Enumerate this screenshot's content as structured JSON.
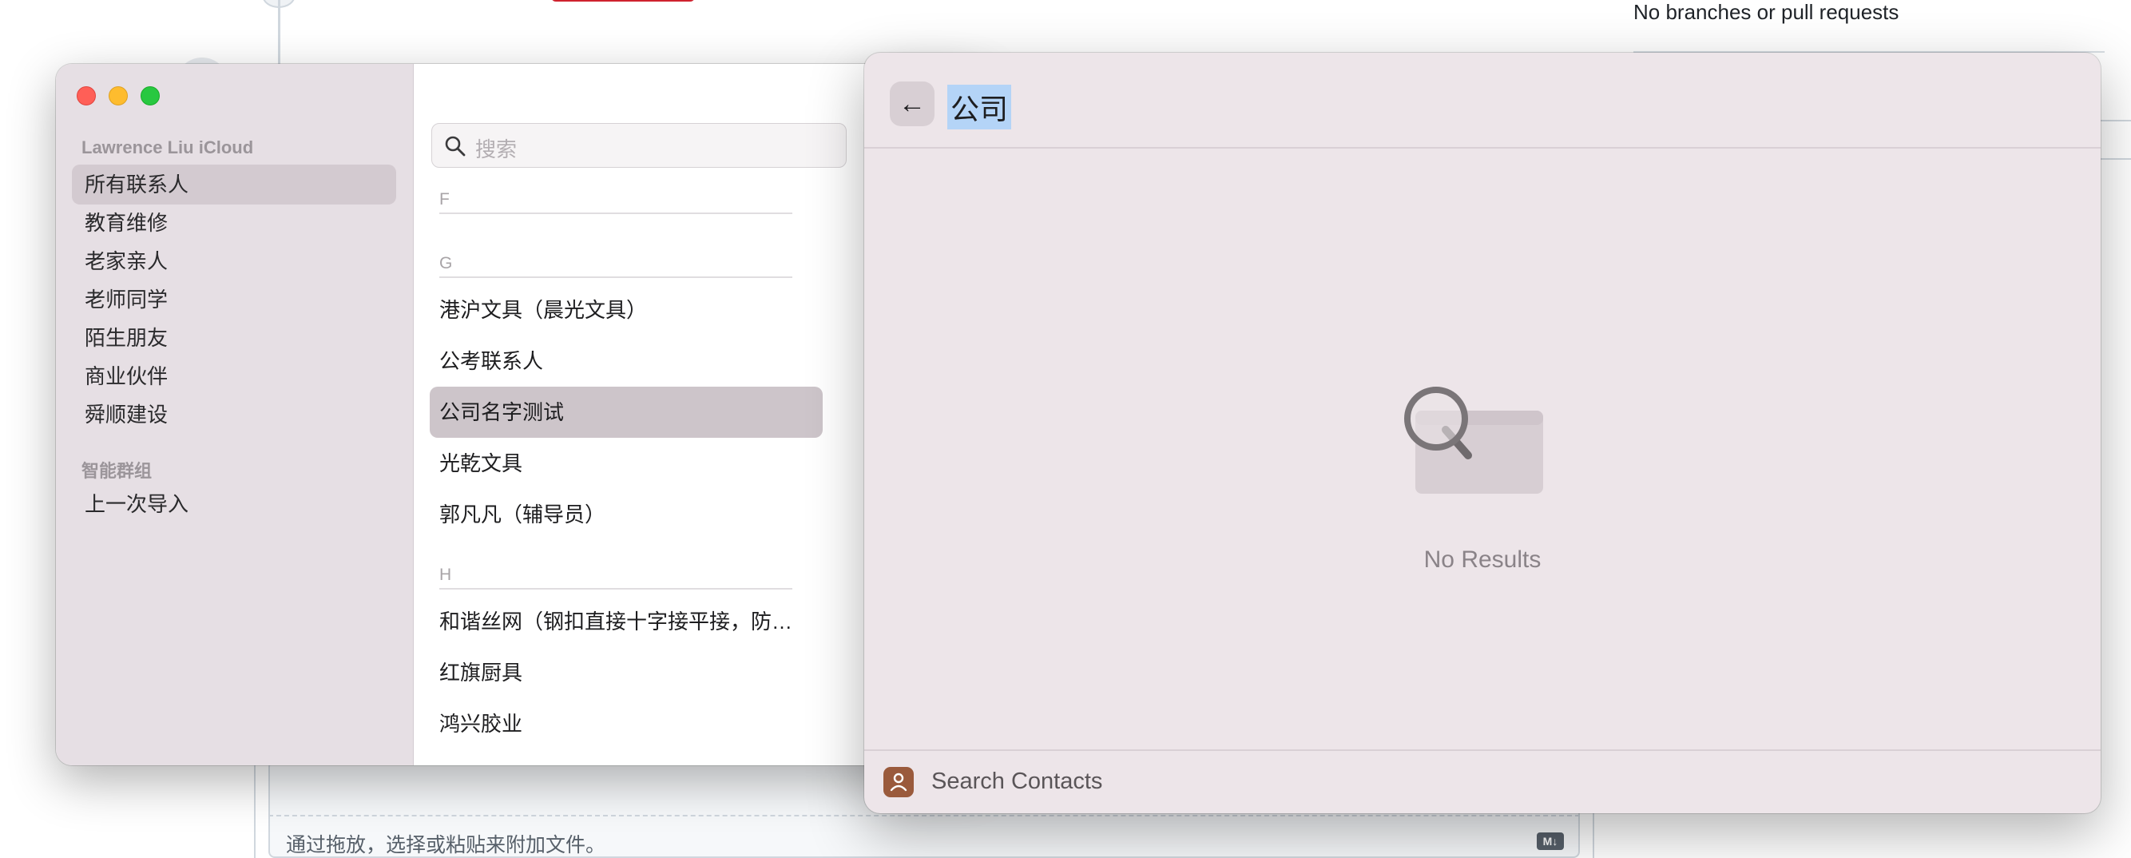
{
  "background_page": {
    "right_panel_text": "No branches or pull requests",
    "attach_hint": "通过拖放，选择或粘贴来附加文件。",
    "markdown_badge": "M↓"
  },
  "contacts": {
    "sidebar": {
      "account_header": "Lawrence Liu iCloud",
      "groups": [
        {
          "label": "所有联系人",
          "selected": true
        },
        {
          "label": "教育维修"
        },
        {
          "label": "老家亲人"
        },
        {
          "label": "老师同学"
        },
        {
          "label": "陌生朋友"
        },
        {
          "label": "商业伙伴"
        },
        {
          "label": "舜顺建设"
        }
      ],
      "smart_groups_header": "智能群组",
      "smart_groups": [
        {
          "label": "上一次导入"
        }
      ]
    },
    "list": {
      "search_placeholder": "搜索",
      "sections": [
        {
          "letter": "F",
          "rows": []
        },
        {
          "letter": "G",
          "rows": [
            {
              "name": "港沪文具（晨光文具）"
            },
            {
              "name": "公考联系人"
            },
            {
              "name": "公司名字测试",
              "selected": true
            },
            {
              "name": "光乾文具"
            },
            {
              "name": "郭凡凡（辅导员）"
            }
          ]
        },
        {
          "letter": "H",
          "rows": [
            {
              "name": "和谐丝网（钢扣直接十字接平接，防…"
            },
            {
              "name": "红旗厨具"
            },
            {
              "name": "鸿兴胶业"
            }
          ]
        }
      ]
    }
  },
  "spotlight": {
    "back_icon": "←",
    "query": "公司",
    "empty_message": "No Results",
    "footer_label": "Search Contacts"
  },
  "colors": {
    "close": "#ff5f57",
    "minimize": "#febc2e",
    "maximize": "#28c840",
    "selection_highlight": "#b4d4f7",
    "contacts_app_icon": "#9a5a3c"
  }
}
